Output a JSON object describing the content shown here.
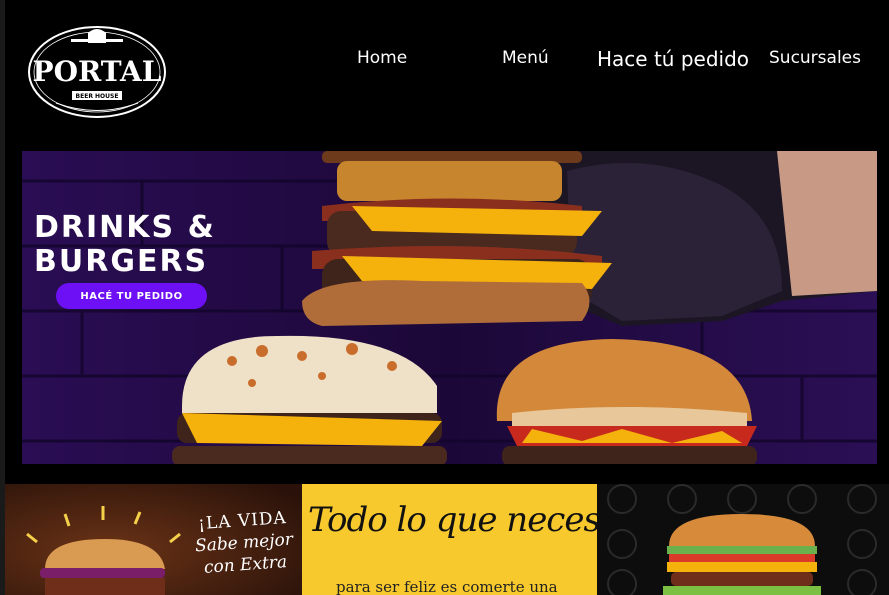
{
  "logo": {
    "main": "PORTAL",
    "sub": "BEER HOUSE"
  },
  "nav": {
    "home": "Home",
    "menu": "Menú",
    "order": "Hace tú pedido",
    "branches": "Sucursales"
  },
  "hero": {
    "title_line1": "DRINKS &",
    "title_line2": "BURGERS",
    "cta": "HACÉ TU PEDIDO"
  },
  "tiles": {
    "promo1": {
      "line1": "¡LA VIDA",
      "line2": "Sabe mejor",
      "line3": "con Extra"
    },
    "promo2": {
      "title": "Todo lo que necesitas",
      "subtitle": "para ser feliz es comerte una"
    }
  },
  "colors": {
    "accent": "#6e10f5",
    "background": "#000000",
    "yellow": "#f8c92c"
  }
}
